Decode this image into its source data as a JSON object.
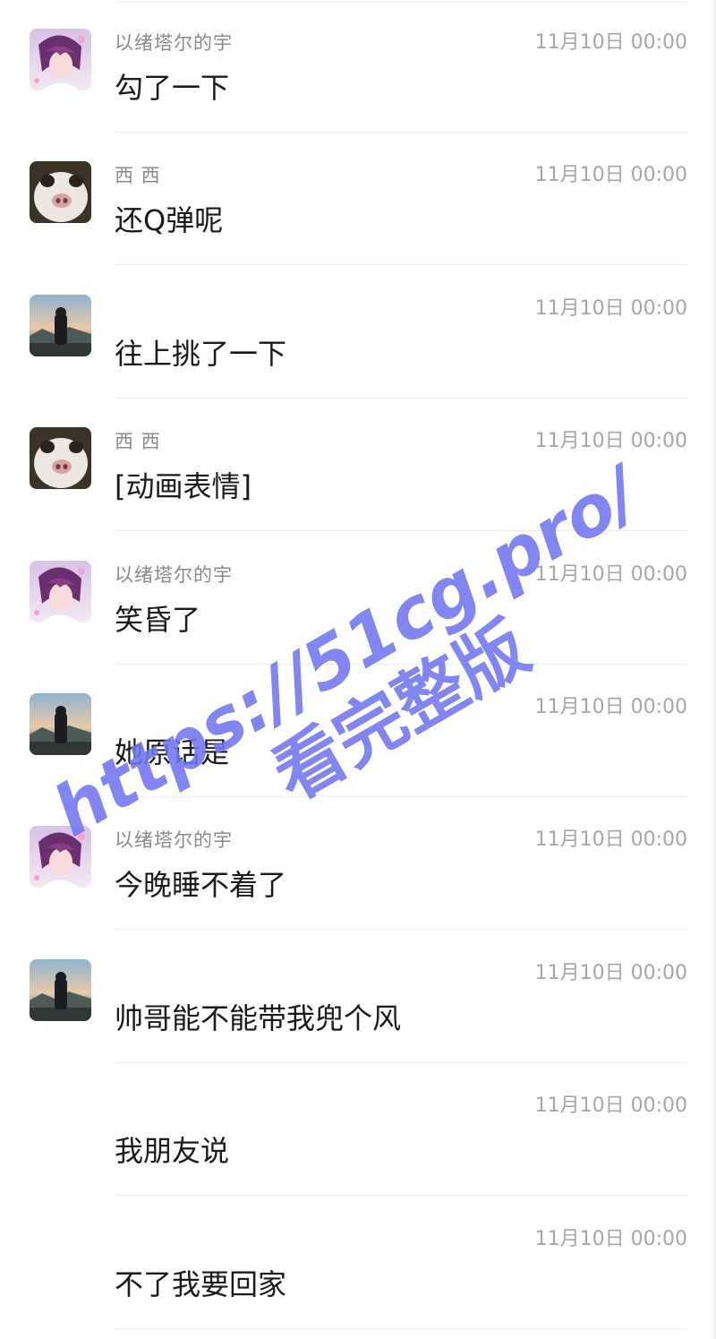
{
  "messages": [
    {
      "sender": "以绪塔尔的宇",
      "time": "11月10日 00:00",
      "text": "勾了一下",
      "avatar": "anime-girl-avatar"
    },
    {
      "sender": "西 西",
      "time": "11月10日 00:00",
      "text": "还Q弹呢",
      "avatar": "rabbit-avatar"
    },
    {
      "sender": "",
      "time": "11月10日 00:00",
      "text": "往上挑了一下",
      "avatar": "landscape-avatar"
    },
    {
      "sender": "西 西",
      "time": "11月10日 00:00",
      "text": "[动画表情]",
      "avatar": "rabbit-avatar"
    },
    {
      "sender": "以绪塔尔的宇",
      "time": "11月10日 00:00",
      "text": "笑昏了",
      "avatar": "anime-girl-avatar"
    },
    {
      "sender": "",
      "time": "11月10日 00:00",
      "text": "她原话是",
      "avatar": "landscape-avatar"
    },
    {
      "sender": "以绪塔尔的宇",
      "time": "11月10日 00:00",
      "text": "今晚睡不着了",
      "avatar": "anime-girl-avatar"
    },
    {
      "sender": "",
      "time": "11月10日 00:00",
      "text": "帅哥能不能带我兜个风",
      "avatar": "landscape-avatar"
    },
    {
      "sender": "",
      "time": "11月10日 00:00",
      "text": "我朋友说",
      "avatar": ""
    },
    {
      "sender": "",
      "time": "11月10日 00:00",
      "text": "不了我要回家",
      "avatar": ""
    }
  ],
  "watermark": {
    "line1": "https://51cg.pro/",
    "line2": "看完整版",
    "color": "#6f75f0"
  }
}
